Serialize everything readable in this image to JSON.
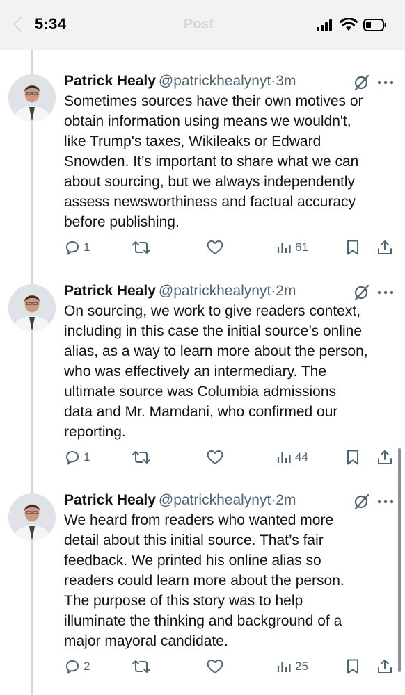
{
  "status_bar": {
    "time": "5:34",
    "header_title": "Post"
  },
  "tweets": [
    {
      "author": "Patrick Healy",
      "handle": "@patrickhealynyt",
      "time": "·3m",
      "text": "Sometimes sources have their own motives or\nobtain information using means we wouldn't,\nlike Trump's taxes, Wikileaks or Edward\nSnowden. It’s important to share what we can\nabout sourcing, but we always independently\nassess newsworthiness and factual accuracy\nbefore publishing.",
      "replies": "1",
      "reposts": "",
      "likes": "",
      "views": "61"
    },
    {
      "author": "Patrick Healy",
      "handle": "@patrickhealynyt",
      "time": "·2m",
      "text": "On sourcing, we work to give readers context,\nincluding in this case the initial source’s online\nalias, as a way to learn more about the person,\nwho was effectively an intermediary. The\nultimate source was Columbia admissions\ndata and Mr. Mamdani, who confirmed our\nreporting.",
      "replies": "1",
      "reposts": "",
      "likes": "",
      "views": "44"
    },
    {
      "author": "Patrick Healy",
      "handle": "@patrickhealynyt",
      "time": "·2m",
      "text": "We heard from readers who wanted more\ndetail about this initial source. That’s fair\nfeedback. We printed his online alias so\nreaders could learn more about the person.\nThe purpose of this story was to help\nilluminate the thinking and background of a\nmajor mayoral candidate.",
      "replies": "2",
      "reposts": "",
      "likes": "",
      "views": "25"
    }
  ],
  "colors": {
    "text": "#0f1419",
    "secondary": "#536471",
    "thread_line": "#cfd9de"
  },
  "icons": [
    "signal-icon",
    "wifi-icon",
    "battery-icon",
    "grok-icon",
    "more-icon",
    "reply-icon",
    "repost-icon",
    "like-icon",
    "views-icon",
    "bookmark-icon",
    "share-icon"
  ]
}
